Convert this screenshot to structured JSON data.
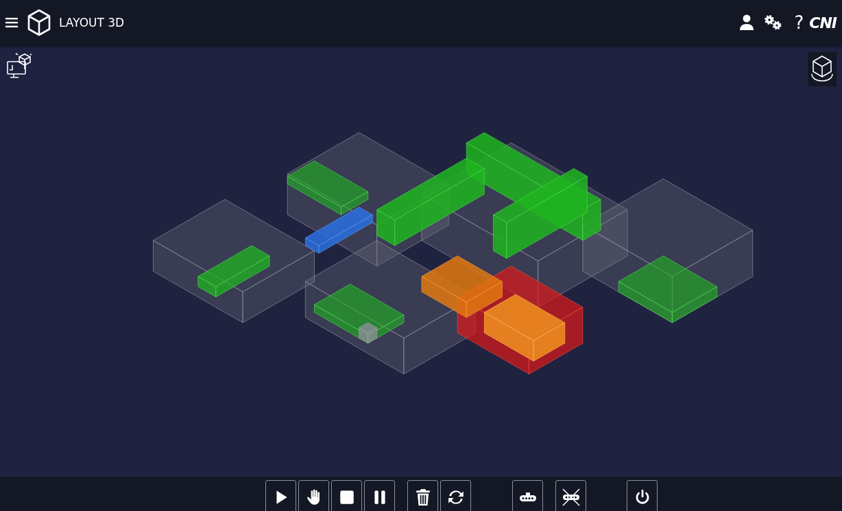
{
  "header": {
    "title": "LAYOUT 3D",
    "help": "?",
    "logo": "CNI"
  },
  "toolbar": {
    "groups": [
      {
        "buttons": [
          {
            "kind": "play"
          },
          {
            "kind": "hand"
          },
          {
            "kind": "stop"
          },
          {
            "kind": "pause"
          }
        ]
      },
      {
        "buttons": [
          {
            "kind": "trash"
          },
          {
            "kind": "refresh"
          }
        ]
      },
      {
        "buttons": [
          {
            "kind": "conveyor"
          }
        ]
      },
      {
        "buttons": [
          {
            "kind": "conveyor-off"
          }
        ]
      },
      {
        "buttons": [
          {
            "kind": "power"
          }
        ]
      }
    ]
  }
}
